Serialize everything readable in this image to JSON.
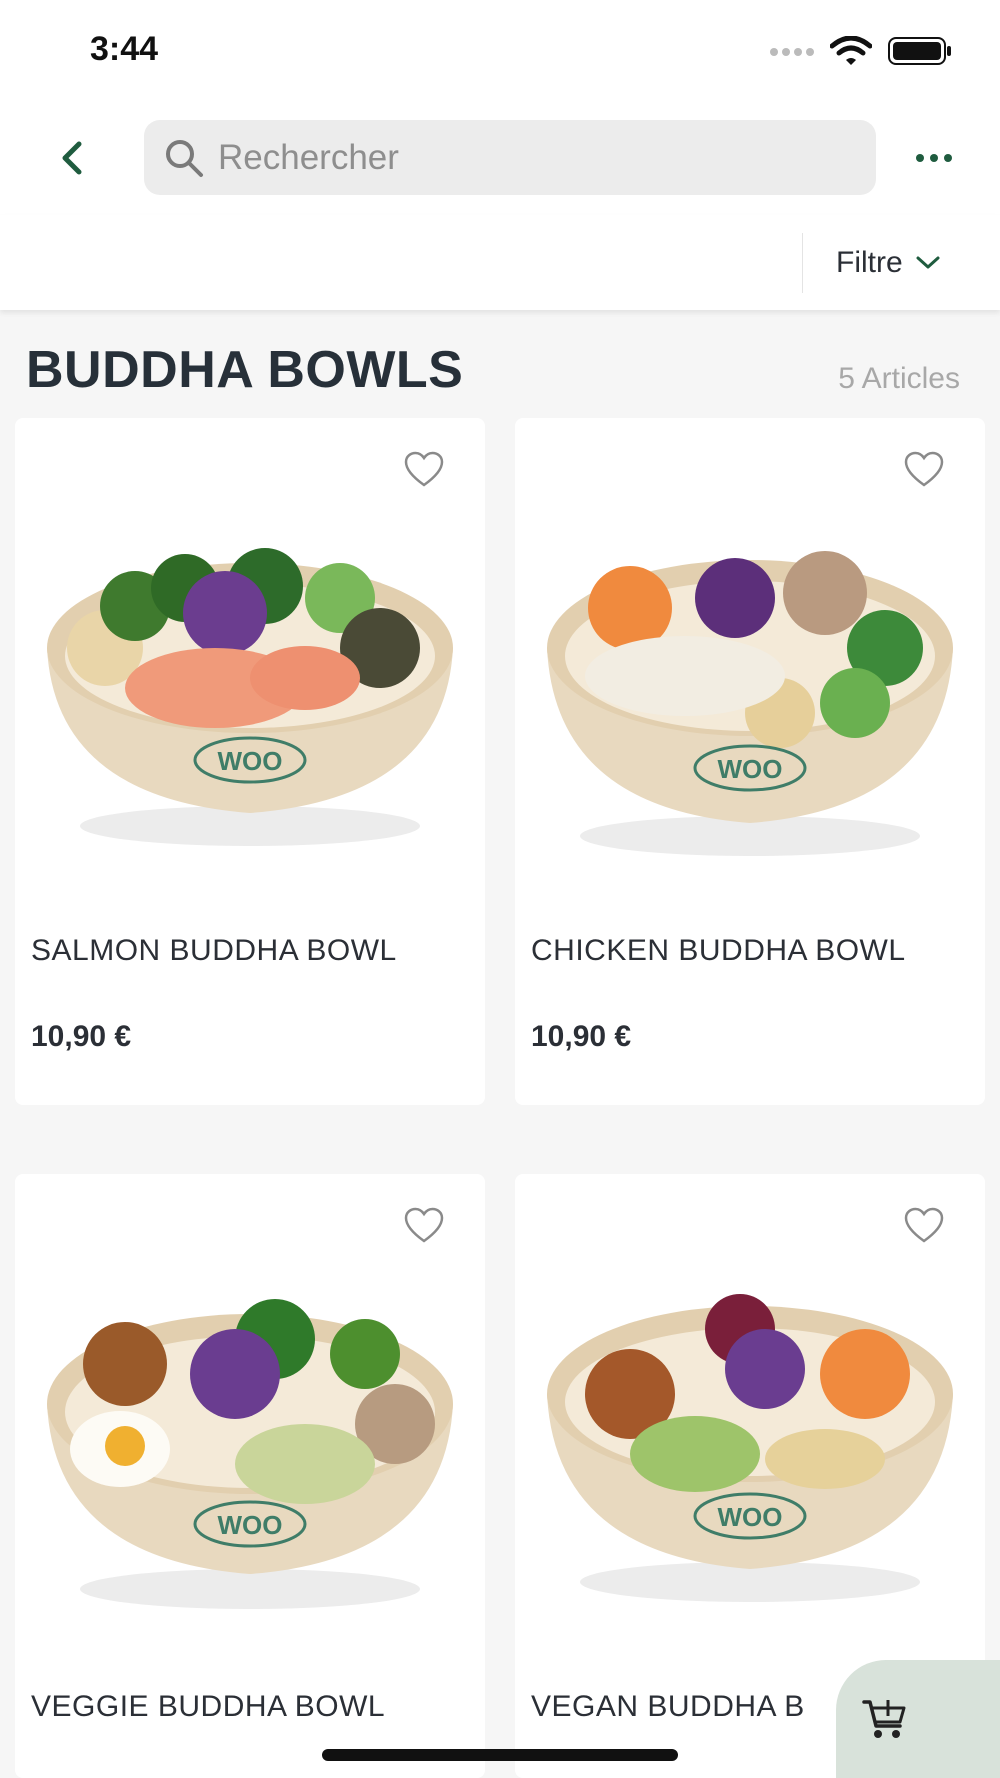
{
  "status_bar": {
    "time": "3:44"
  },
  "search": {
    "placeholder": "Rechercher"
  },
  "filter": {
    "label": "Filtre"
  },
  "section": {
    "title": "BUDDHA BOWLS",
    "count": "5 Articles"
  },
  "products": [
    {
      "name": "SALMON BUDDHA BOWL",
      "price": "10,90 €"
    },
    {
      "name": "CHICKEN BUDDHA BOWL",
      "price": "10,90 €"
    },
    {
      "name": "VEGGIE BUDDHA BOWL",
      "price": ""
    },
    {
      "name": "VEGAN BUDDHA B",
      "price": ""
    }
  ],
  "bowl_logo": "WOO",
  "colors": {
    "accent": "#1f5c3f",
    "cart_bg": "#d8e2da",
    "bowl": "#e8d9bf"
  },
  "icons": [
    "back-icon",
    "search-icon",
    "more-icon",
    "chevron-down-icon",
    "heart-icon",
    "cart-add-icon"
  ]
}
